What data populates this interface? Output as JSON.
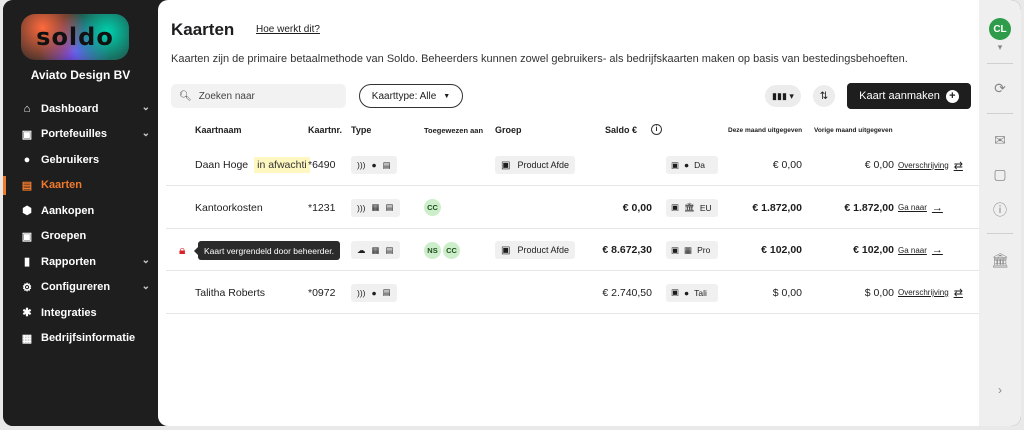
{
  "brand": {
    "logo_text": "soldo",
    "company": "Aviato Design BV"
  },
  "sidebar": {
    "items": [
      {
        "label": "Dashboard",
        "icon": "home-icon",
        "chevron": true,
        "active": false
      },
      {
        "label": "Portefeuilles",
        "icon": "wallet-icon",
        "chevron": true,
        "active": false
      },
      {
        "label": "Gebruikers",
        "icon": "user-icon",
        "chevron": false,
        "active": false
      },
      {
        "label": "Kaarten",
        "icon": "card-icon",
        "chevron": false,
        "active": true
      },
      {
        "label": "Aankopen",
        "icon": "purchase-icon",
        "chevron": false,
        "active": false
      },
      {
        "label": "Groepen",
        "icon": "group-icon",
        "chevron": false,
        "active": false
      },
      {
        "label": "Rapporten",
        "icon": "chart-icon",
        "chevron": true,
        "active": false
      },
      {
        "label": "Configureren",
        "icon": "gear-icon",
        "chevron": true,
        "active": false
      },
      {
        "label": "Integraties",
        "icon": "puzzle-icon",
        "chevron": false,
        "active": false
      },
      {
        "label": "Bedrijfsinformatie",
        "icon": "building-icon",
        "chevron": false,
        "active": false
      }
    ]
  },
  "page": {
    "title": "Kaarten",
    "help_link": "Hoe werkt dit?",
    "subtitle": "Kaarten zijn de primaire betaalmethode van Soldo. Beheerders kunnen zowel gebruikers- als bedrijfskaarten maken op basis van bestedingsbehoeften."
  },
  "toolbar": {
    "search_placeholder": "Zoeken naar",
    "filter_label": "Kaarttype: Alle",
    "create_label": "Kaart aanmaken"
  },
  "table": {
    "headers": {
      "name": "Kaartnaam",
      "number": "Kaartnr.",
      "type": "Type",
      "assigned": "Toegewezen aan",
      "group": "Groep",
      "balance": "Saldo €",
      "this_month": "Deze maand uitgegeven",
      "last_month": "Vorige maand uitgegeven"
    },
    "rows": [
      {
        "name": "Daan Hoge",
        "status": "in afwachti",
        "number": "*6490",
        "type_icons": [
          "contactless-icon",
          "user-icon",
          "card-icon"
        ],
        "assigned": [],
        "group": "Product Afde",
        "balance": "",
        "wallet": "Da",
        "wallet_icons": [
          "wallet-icon",
          "user-icon"
        ],
        "this_month": "€ 0,00",
        "last_month": "€ 0,00",
        "action": "Overschrijving",
        "action_icon": "swap-icon",
        "locked": false,
        "bold_amounts": false
      },
      {
        "name": "Kantoorkosten",
        "status": "",
        "number": "*1231",
        "type_icons": [
          "contactless-icon",
          "building-icon",
          "card-icon"
        ],
        "assigned": [
          "CC"
        ],
        "group": "",
        "balance": "€ 0,00",
        "wallet": "EU",
        "wallet_icons": [
          "wallet-icon",
          "bank-icon"
        ],
        "this_month": "€ 1.872,00",
        "last_month": "€ 1.872,00",
        "action": "Ga naar",
        "action_icon": "arrow-right-icon",
        "locked": false,
        "bold_amounts": true
      },
      {
        "name": "",
        "status": "",
        "number": "",
        "type_icons": [
          "cloud-icon",
          "building-icon",
          "card-icon"
        ],
        "assigned": [
          "NS",
          "CC"
        ],
        "group": "Product Afde",
        "balance": "€ 8.672,30",
        "wallet": "Pro",
        "wallet_icons": [
          "wallet-icon",
          "department-icon"
        ],
        "this_month": "€ 102,00",
        "last_month": "€ 102,00",
        "action": "Ga naar",
        "action_icon": "arrow-right-icon",
        "locked": true,
        "tooltip": "Kaart vergrendeld door beheerder.",
        "bold_amounts": true
      },
      {
        "name": "Talitha Roberts",
        "status": "",
        "number": "*0972",
        "type_icons": [
          "contactless-icon",
          "user-icon",
          "card-icon"
        ],
        "assigned": [],
        "group": "",
        "balance": "€ 2.740,50",
        "wallet": "Tali",
        "wallet_icons": [
          "wallet-icon",
          "user-icon"
        ],
        "this_month": "$ 0,00",
        "last_month": "$ 0,00",
        "action": "Overschrijving",
        "action_icon": "swap-icon",
        "locked": false,
        "bold_amounts": false
      }
    ]
  },
  "rail": {
    "avatar": "CL",
    "icons": [
      "chevron-down-icon",
      "refresh-icon",
      "mail-icon",
      "chat-icon",
      "help-icon",
      "bank-icon",
      "chevron-right-icon"
    ]
  }
}
